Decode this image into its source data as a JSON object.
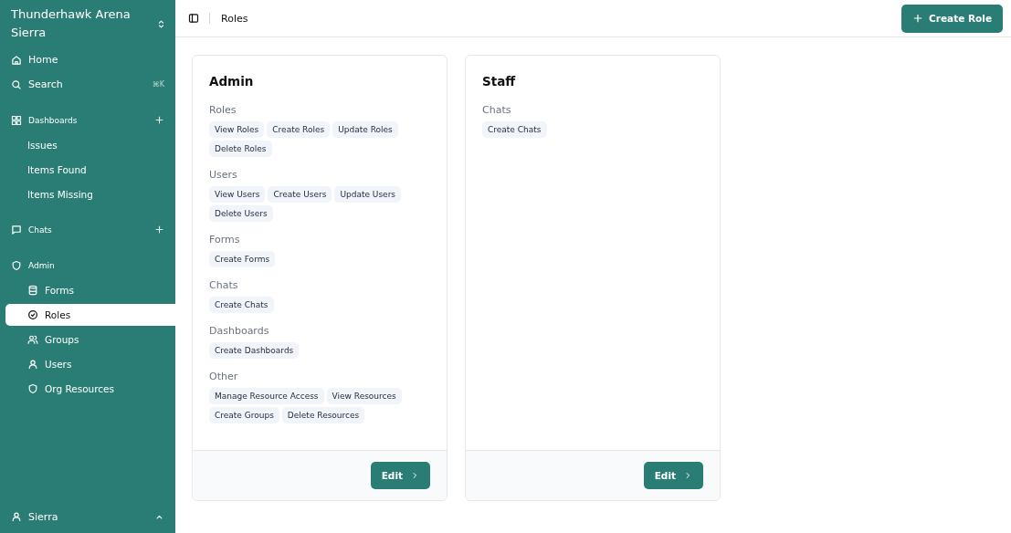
{
  "sidebar": {
    "org_name": "Thunderhawk Arena Sierra",
    "nav": [
      {
        "label": "Home"
      },
      {
        "label": "Search",
        "shortcut": "⌘K"
      }
    ],
    "sections": [
      {
        "title": "Dashboards",
        "add": true,
        "items": [
          {
            "label": "Issues",
            "selected": false
          },
          {
            "label": "Items Found",
            "selected": false
          },
          {
            "label": "Items Missing",
            "selected": false
          }
        ]
      },
      {
        "title": "Chats",
        "add": true
      },
      {
        "title": "Admin",
        "add": false,
        "items": [
          {
            "label": "Forms",
            "selected": false
          },
          {
            "label": "Roles",
            "selected": true
          },
          {
            "label": "Groups",
            "selected": false
          },
          {
            "label": "Users",
            "selected": false
          },
          {
            "label": "Org Resources",
            "selected": false
          }
        ]
      }
    ],
    "user": {
      "name": "Sierra"
    }
  },
  "header": {
    "breadcrumb": "Roles",
    "action": "Create Role"
  },
  "roles": [
    {
      "name": "Admin",
      "groups": [
        {
          "label": "Roles",
          "permissions": [
            "View Roles",
            "Create Roles",
            "Update Roles",
            "Delete Roles"
          ]
        },
        {
          "label": "Users",
          "permissions": [
            "View Users",
            "Create Users",
            "Update Users",
            "Delete Users"
          ]
        },
        {
          "label": "Forms",
          "permissions": [
            "Create Forms"
          ]
        },
        {
          "label": "Chats",
          "permissions": [
            "Create Chats"
          ]
        },
        {
          "label": "Dashboards",
          "permissions": [
            "Create Dashboards"
          ]
        },
        {
          "label": "Other",
          "permissions": [
            "Manage Resource Access",
            "View Resources",
            "Create Groups",
            "Delete Resources"
          ]
        }
      ],
      "button": "Edit"
    },
    {
      "name": "Staff",
      "groups": [
        {
          "label": "Chats",
          "permissions": [
            "Create Chats"
          ]
        }
      ],
      "button": "Edit"
    }
  ]
}
